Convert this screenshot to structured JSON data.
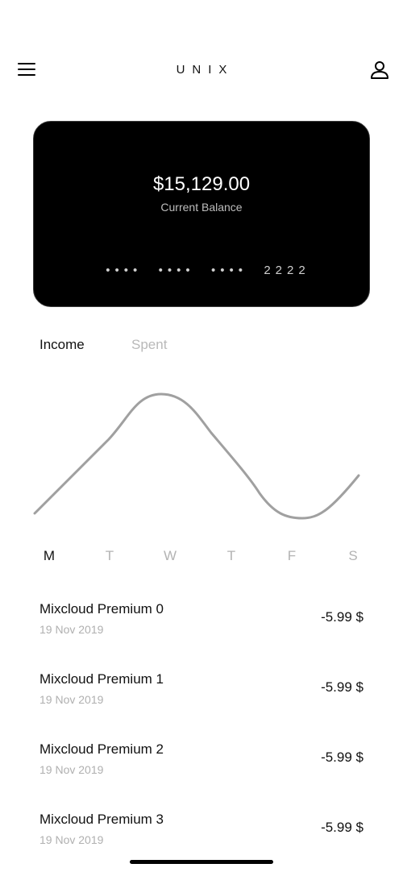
{
  "header": {
    "brand": "UNIX",
    "menu_icon": "hamburger-menu-icon",
    "profile_icon": "user-profile-icon"
  },
  "card": {
    "balance": "$15,129.00",
    "balance_label": "Current Balance",
    "card_number": "••••  ••••  ••••  2222"
  },
  "tabs": [
    {
      "label": "Income",
      "active": true
    },
    {
      "label": "Spent",
      "active": false
    }
  ],
  "chart": {
    "line_color": "#a0a0a0"
  },
  "days": [
    {
      "label": "M",
      "active": true
    },
    {
      "label": "T",
      "active": false
    },
    {
      "label": "W",
      "active": false
    },
    {
      "label": "T",
      "active": false
    },
    {
      "label": "F",
      "active": false
    },
    {
      "label": "S",
      "active": false
    }
  ],
  "transactions": [
    {
      "title": "Mixcloud Premium 0",
      "date": "19 Nov 2019",
      "amount": "-5.99 $"
    },
    {
      "title": "Mixcloud Premium 1",
      "date": "19 Nov 2019",
      "amount": "-5.99 $"
    },
    {
      "title": "Mixcloud Premium 2",
      "date": "19 Nov 2019",
      "amount": "-5.99 $"
    },
    {
      "title": "Mixcloud Premium 3",
      "date": "19 Nov 2019",
      "amount": "-5.99 $"
    }
  ]
}
